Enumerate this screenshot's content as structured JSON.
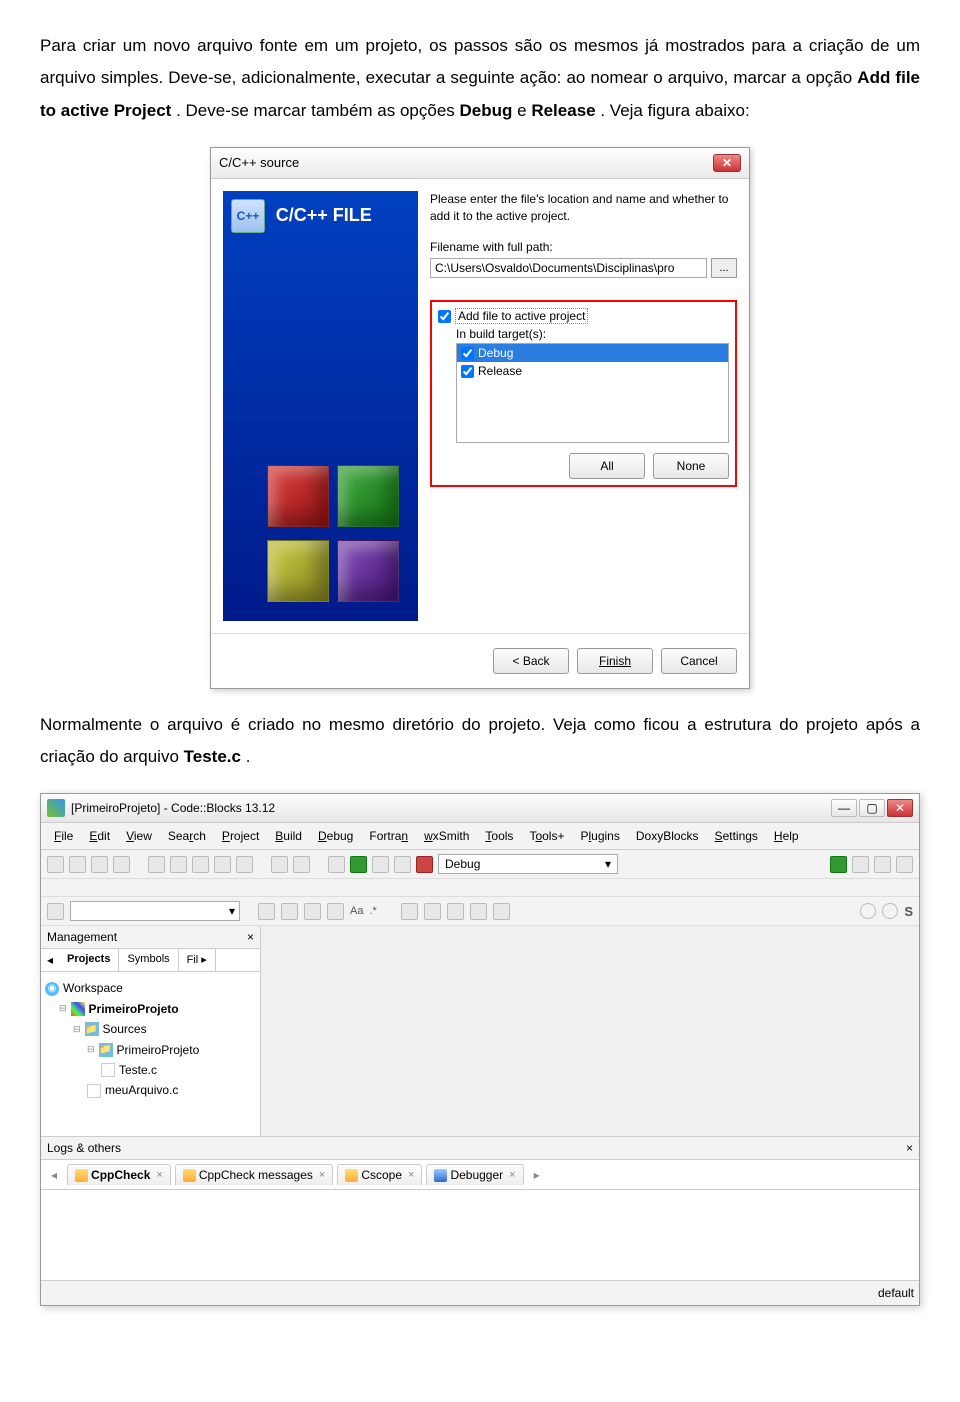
{
  "para1_a": "Para criar um novo arquivo fonte em um projeto, os passos são os mesmos já mostrados para a criação de um arquivo simples. Deve-se, adicionalmente, executar a seguinte ação: ao nomear o arquivo, marcar a opção ",
  "para1_bold1": "Add file to active Project",
  "para1_b": ". Deve-se marcar também as opções ",
  "para1_bold2": "Debug",
  "para1_c": " e ",
  "para1_bold3": "Release",
  "para1_d": ". Veja figura abaixo:",
  "dialog": {
    "title": "C/C++ source",
    "file_label": "C/C++ FILE",
    "instruction": "Please enter the file's location and name and whether to add it to the active project.",
    "filename_label": "Filename with full path:",
    "path_value": "C:\\Users\\Osvaldo\\Documents\\Disciplinas\\pro",
    "browse": "...",
    "add_file_label": "Add file to active project",
    "in_build_label": "In build target(s):",
    "target_debug": "Debug",
    "target_release": "Release",
    "all_btn": "All",
    "none_btn": "None",
    "back_btn": "< Back",
    "finish_btn": "Finish",
    "cancel_btn": "Cancel"
  },
  "para2_a": "Normalmente o arquivo é criado no mesmo diretório do projeto. Veja como ficou a estrutura do projeto após a criação do arquivo ",
  "para2_bold": "Teste.c",
  "para2_b": ".",
  "ide": {
    "title": "[PrimeiroProjeto] - Code::Blocks 13.12",
    "menus": [
      "File",
      "Edit",
      "View",
      "Search",
      "Project",
      "Build",
      "Debug",
      "Fortran",
      "wxSmith",
      "Tools",
      "Tools+",
      "Plugins",
      "DoxyBlocks",
      "Settings",
      "Help"
    ],
    "build_combo": "Debug",
    "mgmt_title": "Management",
    "tabs": {
      "projects": "Projects",
      "symbols": "Symbols",
      "files": "Fil"
    },
    "tree": {
      "workspace": "Workspace",
      "project": "PrimeiroProjeto",
      "sources": "Sources",
      "folder": "PrimeiroProjeto",
      "file1": "Teste.c",
      "file2": "meuArquivo.c"
    },
    "logs_title": "Logs & others",
    "log_tabs": {
      "cppcheck": "CppCheck",
      "cppmsg": "CppCheck messages",
      "cscope": "Cscope",
      "debugger": "Debugger"
    },
    "status": "default"
  }
}
